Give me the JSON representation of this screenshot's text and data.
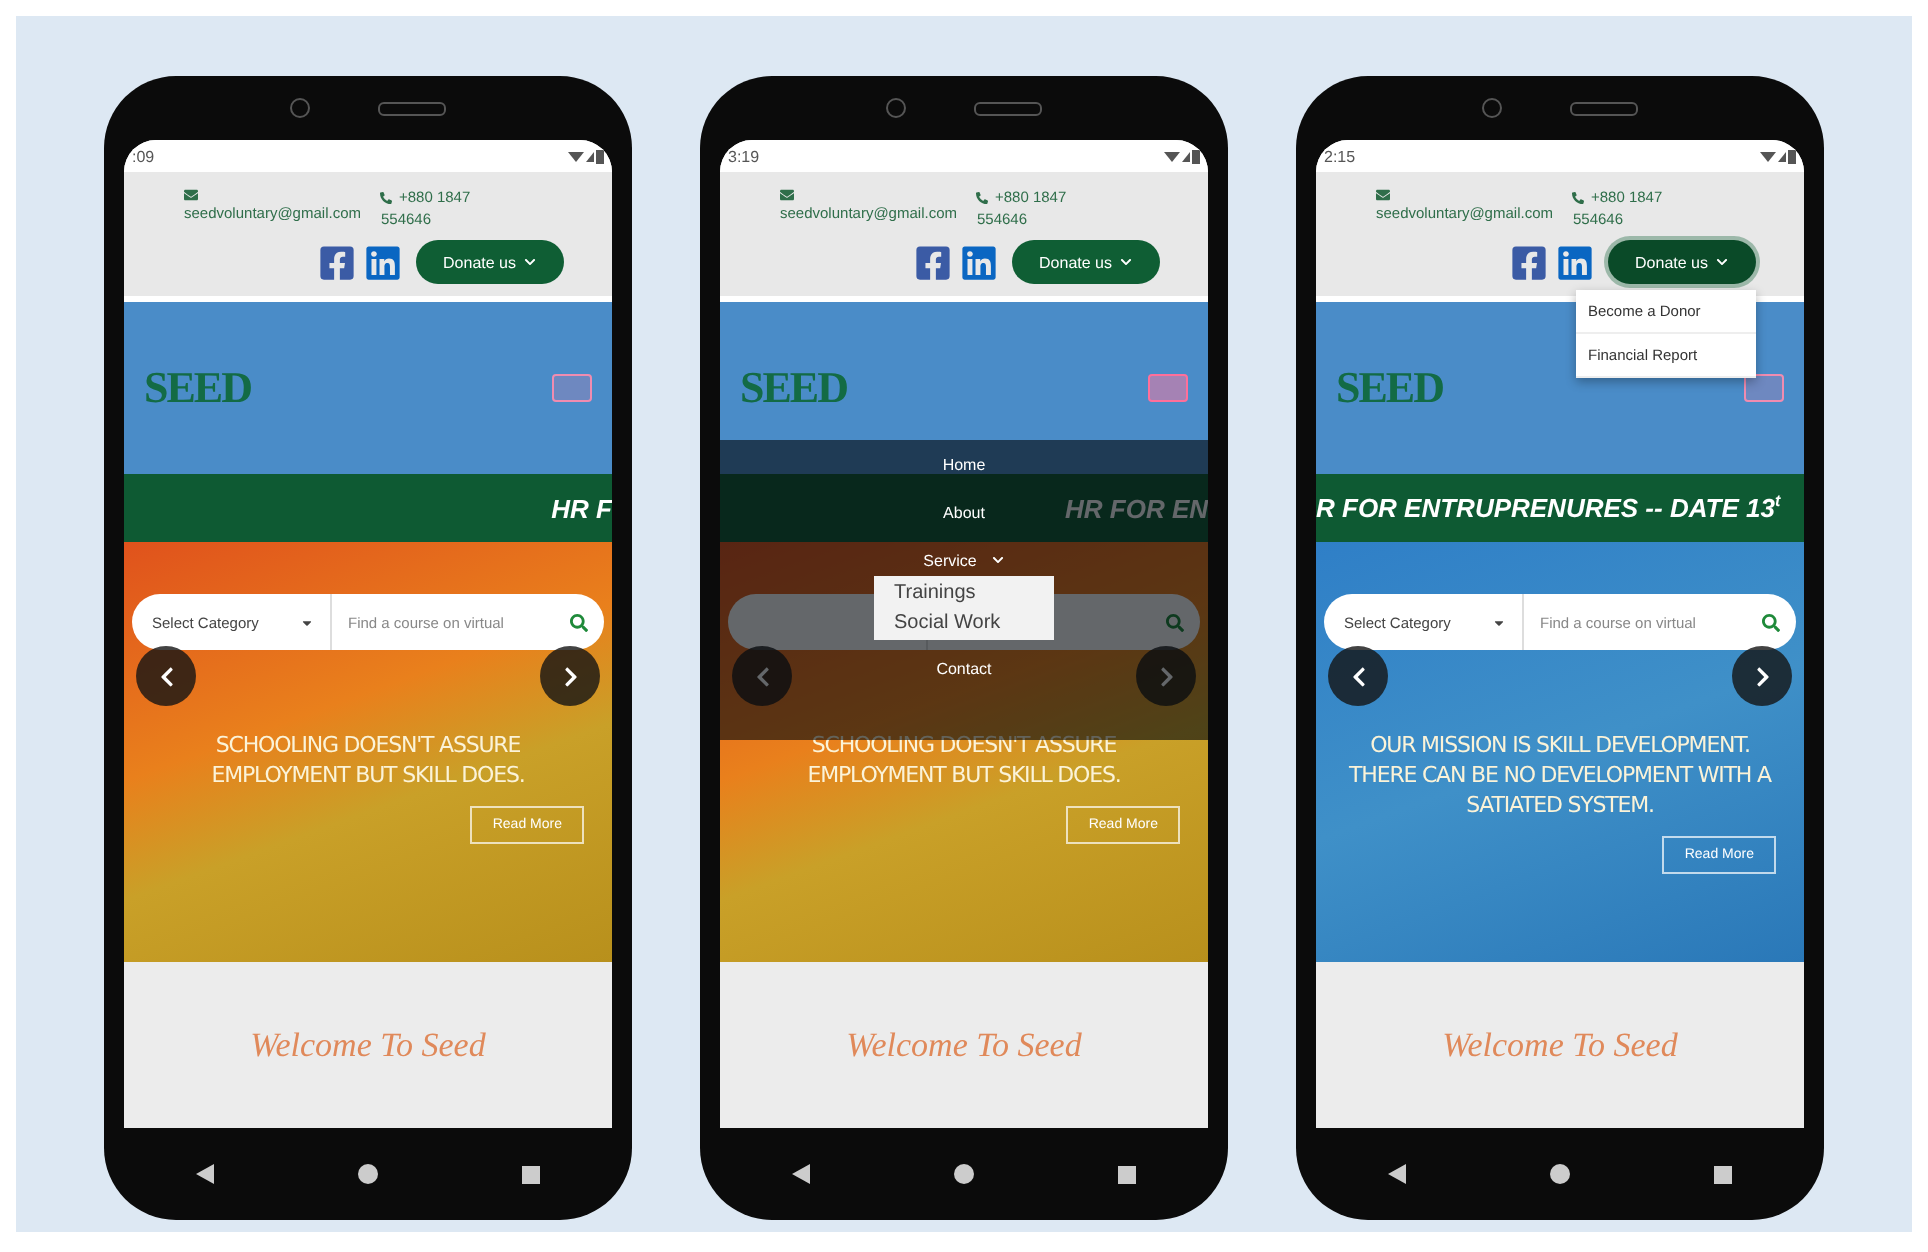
{
  "phones": [
    {
      "time": ":09",
      "email": "seedvoluntary@gmail.com",
      "phone": [
        "+880 1847",
        "554646"
      ],
      "donate": {
        "label": "Donate us",
        "open": false
      },
      "menu": {
        "open": false
      },
      "logo": "SEED",
      "ticker": {
        "text": "HR F",
        "kind": "tail"
      },
      "search": {
        "category": "Select Category",
        "placeholder": "Find a course on virtual"
      },
      "hero": {
        "kind": "warm",
        "slogan": "SCHOOLING DOESN'T ASSURE EMPLOYMENT BUT SKILL DOES.",
        "button": "Read More"
      },
      "welcome": "Welcome To Seed"
    },
    {
      "time": "3:19",
      "email": "seedvoluntary@gmail.com",
      "phone": [
        "+880 1847",
        "554646"
      ],
      "donate": {
        "label": "Donate us",
        "open": false
      },
      "menu": {
        "open": true,
        "items": [
          {
            "label": "Home",
            "expanded": false
          },
          {
            "label": "About",
            "expanded": false
          },
          {
            "label": "Service",
            "expanded": true,
            "children": [
              {
                "label": "Trainings"
              },
              {
                "label": "Social Work"
              }
            ]
          },
          {
            "label": "Contact",
            "expanded": false
          }
        ]
      },
      "logo": "SEED",
      "ticker": {
        "text": "HR FOR EN",
        "kind": "tail"
      },
      "hero": {
        "kind": "warm",
        "slogan": "SCHOOLING DOESN'T ASSURE EMPLOYMENT BUT SKILL DOES.",
        "button": "Read More"
      },
      "welcome": "Welcome To Seed"
    },
    {
      "time": "2:15",
      "email": "seedvoluntary@gmail.com",
      "phone": [
        "+880 1847",
        "554646"
      ],
      "donate": {
        "label": "Donate us",
        "open": true,
        "items": [
          "Become a Donor",
          "Financial Report"
        ]
      },
      "menu": {
        "open": false
      },
      "logo": "SEED",
      "ticker": {
        "text": "R FOR ENTRUPRENURES -- DATE 13$^{t}$",
        "kind": "head"
      },
      "search": {
        "category": "Select Category",
        "placeholder": "Find a course on virtual"
      },
      "hero": {
        "kind": "cool",
        "slogan": "OUR MISSION IS SKILL DEVELOPMENT. THERE CAN BE NO DEVELOPMENT WITH A SATIATED SYSTEM.",
        "button": "Read More"
      },
      "welcome": "Welcome To Seed"
    }
  ]
}
